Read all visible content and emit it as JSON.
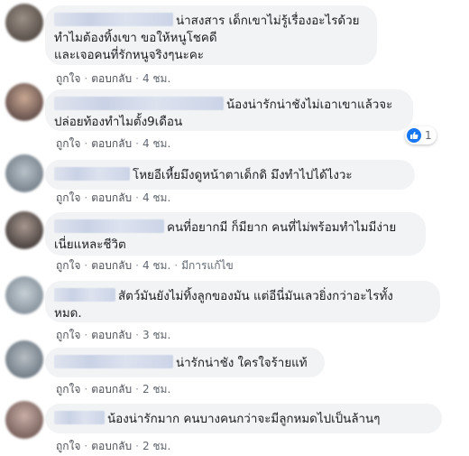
{
  "labels": {
    "like": "ถูกใจ",
    "reply": "ตอบกลับ",
    "separator": "·",
    "edited": "มีการแก้ไข"
  },
  "comments": [
    {
      "text": "น่าสงสาร เด็กเขาไม่รู้เรื่องอะไรด้วย\nทำไมต้องทิ้งเขา ขอให้หนูโชคดี\nและเจอคนที่รักหนูจริงๆนะคะ",
      "time": "4 ชม."
    },
    {
      "text": "น้องน่ารักน่าชังไม่เอาเขาแล้วจะ\nปล่อยท้องทำไมตั้ง9เดือน",
      "time": "4 ชม.",
      "reactions": "1"
    },
    {
      "text": "โหยอีเหี้ยมึงดูหน้าตาเด็กดิ มึงทำไปได้ไงวะ",
      "time": "4 ชม."
    },
    {
      "text": "คนที่อยากมี ก็มียาก คนที่ไม่พร้อมทำไมมีง่าย\nเนี่ยแหละชีวิต",
      "time": "4 ชม."
    },
    {
      "text": "สัตว์มันยังไม่ทิ้งลูกของมัน แต่อีนี่มันเลวยิ่งกว่าอะไรทั้ง\nหมด.",
      "time": "3 ชม."
    },
    {
      "text": "น่ารักน่าชัง ใครใจร้ายแท้",
      "time": "2 ชม."
    },
    {
      "text": "น้องน่ารักมาก คนบางคนกว่าจะมีลูกหมดไปเป็นล้านๆ",
      "time": "2 ชม."
    }
  ],
  "colors": {
    "bubble": "#f2f3f5",
    "like_icon": "#1877f2",
    "meta": "#606770"
  }
}
